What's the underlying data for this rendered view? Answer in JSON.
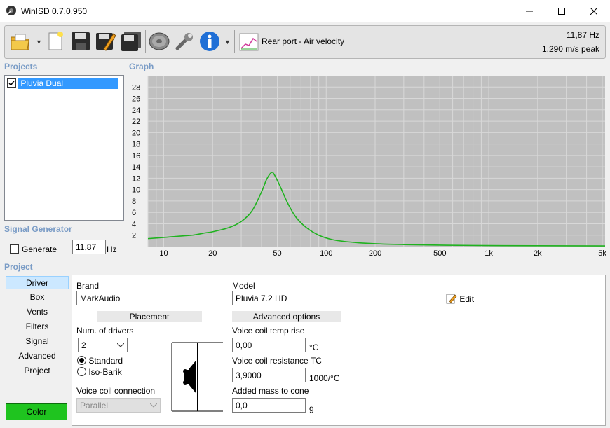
{
  "window": {
    "title": "WinISD 0.7.0.950"
  },
  "toolbar": {
    "graph_selector_label": "Rear port - Air velocity",
    "readout_freq": "11,87 Hz",
    "readout_value": "1,290 m/s peak"
  },
  "projects": {
    "label": "Projects",
    "items": [
      {
        "name": "Pluvia Dual",
        "checked": true
      }
    ]
  },
  "graph": {
    "label": "Graph"
  },
  "chart_data": {
    "type": "line",
    "title": "",
    "xlabel": "",
    "ylabel": "",
    "x_scale": "log",
    "xlim": [
      8,
      5200
    ],
    "ylim": [
      0,
      30
    ],
    "y_ticks": [
      2,
      4,
      6,
      8,
      10,
      12,
      14,
      16,
      18,
      20,
      22,
      24,
      26,
      28
    ],
    "x_ticks": [
      {
        "v": 10,
        "l": "10"
      },
      {
        "v": 20,
        "l": "20"
      },
      {
        "v": 50,
        "l": "50"
      },
      {
        "v": 100,
        "l": "100"
      },
      {
        "v": 200,
        "l": "200"
      },
      {
        "v": 500,
        "l": "500"
      },
      {
        "v": 1000,
        "l": "1k"
      },
      {
        "v": 2000,
        "l": "2k"
      },
      {
        "v": 5000,
        "l": "5k"
      }
    ],
    "grid": true,
    "series": [
      {
        "color": "#1fb21f",
        "x": [
          8,
          10,
          12,
          15,
          18,
          20,
          25,
          30,
          35,
          40,
          43,
          46,
          48,
          52,
          58,
          65,
          75,
          90,
          110,
          140,
          200,
          300,
          500,
          1000,
          2000,
          5200
        ],
        "y": [
          1.4,
          1.6,
          1.8,
          2.0,
          2.4,
          2.6,
          3.3,
          4.4,
          6.3,
          9.6,
          11.8,
          13.0,
          12.6,
          10.6,
          7.6,
          5.2,
          3.4,
          2.0,
          1.2,
          0.8,
          0.5,
          0.35,
          0.25,
          0.18,
          0.15,
          0.12
        ]
      }
    ]
  },
  "signal_generator": {
    "label": "Signal Generator",
    "generate_label": "Generate",
    "frequency_value": "11,87",
    "unit": "Hz"
  },
  "project": {
    "label": "Project",
    "nav": [
      "Driver",
      "Box",
      "Vents",
      "Filters",
      "Signal",
      "Advanced",
      "Project"
    ],
    "color_button": "Color"
  },
  "driver": {
    "brand_label": "Brand",
    "brand_value": "MarkAudio",
    "model_label": "Model",
    "model_value": "Pluvia 7.2 HD",
    "edit_label": "Edit",
    "placement_header": "Placement",
    "num_drivers_label": "Num. of drivers",
    "num_drivers_value": "2",
    "standard_label": "Standard",
    "isobarik_label": "Iso-Barik",
    "vc_connection_label": "Voice coil connection",
    "vc_connection_value": "Parallel",
    "advanced_header": "Advanced options",
    "vc_temp_label": "Voice coil temp rise",
    "vc_temp_value": "0,00",
    "vc_temp_unit": "°C",
    "vc_res_label": "Voice coil resistance TC",
    "vc_res_value": "3,9000",
    "vc_res_unit": "1000/°C",
    "added_mass_label": "Added mass to cone",
    "added_mass_value": "0,0",
    "added_mass_unit": "g"
  }
}
